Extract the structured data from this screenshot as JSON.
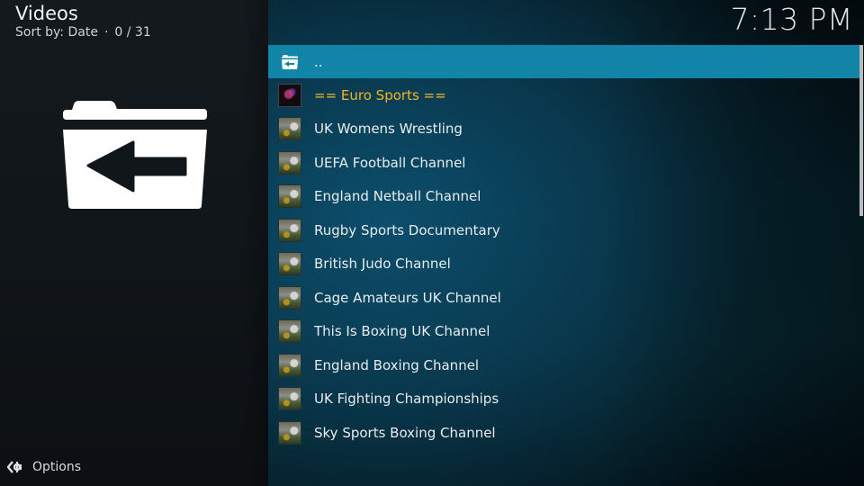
{
  "header": {
    "title": "Videos",
    "sort_label": "Sort by: Date",
    "separator": "·",
    "position": "0 / 31"
  },
  "clock": "7:13 PM",
  "big_icon": "folder-back-icon",
  "options": {
    "icon": "options-gear-icon",
    "label": "Options"
  },
  "list": {
    "items": [
      {
        "label": "..",
        "icon": "folder-back-icon",
        "focused": true
      },
      {
        "label": "== Euro Sports ==",
        "icon": "euro-sports-thumbnail",
        "highlight_color": "#f0b429"
      },
      {
        "label": "UK Womens Wrestling",
        "icon": "channel-thumbnail"
      },
      {
        "label": "UEFA Football Channel",
        "icon": "channel-thumbnail"
      },
      {
        "label": "England Netball Channel",
        "icon": "channel-thumbnail"
      },
      {
        "label": "Rugby Sports Documentary",
        "icon": "channel-thumbnail"
      },
      {
        "label": "British Judo Channel",
        "icon": "channel-thumbnail"
      },
      {
        "label": "Cage Amateurs UK Channel",
        "icon": "channel-thumbnail"
      },
      {
        "label": "This Is Boxing UK Channel",
        "icon": "channel-thumbnail"
      },
      {
        "label": "England Boxing Channel",
        "icon": "channel-thumbnail"
      },
      {
        "label": "UK Fighting Championships",
        "icon": "channel-thumbnail"
      },
      {
        "label": "Sky Sports Boxing Channel",
        "icon": "channel-thumbnail"
      }
    ]
  },
  "colors": {
    "focus": "#1284a8",
    "accent_gold": "#f0b429",
    "text": "#e8ecee"
  }
}
